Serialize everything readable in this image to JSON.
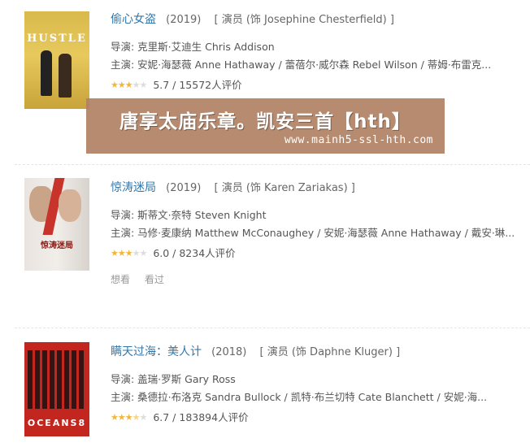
{
  "movies": [
    {
      "title": "偷心女盗",
      "year": "(2019)",
      "role": "[ 演员 (饰 Josephine Chesterfield) ]",
      "director": "导演: 克里斯·艾迪生 Chris Addison",
      "cast": "主演: 安妮·海瑟薇 Anne Hathaway / 蕾蓓尔·威尔森 Rebel Wilson / 蒂姆·布雷克...",
      "rating": "5.7 / 15572人评价",
      "stars": 3,
      "poster_text": "HUSTLE"
    },
    {
      "title": "惊涛迷局",
      "year": "(2019)",
      "role": "[ 演员 (饰 Karen Zariakas) ]",
      "director": "导演: 斯蒂文·奈特 Steven Knight",
      "cast": "主演: 马修·麦康纳 Matthew McConaughey / 安妮·海瑟薇 Anne Hathaway / 戴安·琳...",
      "rating": "6.0 / 8234人评价",
      "stars": 3,
      "actions": [
        "想看",
        "看过"
      ],
      "poster_text": "惊涛迷局"
    },
    {
      "title": "瞒天过海：美人计",
      "year": "(2018)",
      "role": "[ 演员 (饰 Daphne Kluger) ]",
      "director": "导演: 盖瑞·罗斯 Gary Ross",
      "cast": "主演: 桑德拉·布洛克 Sandra Bullock / 凯特·布兰切特 Cate Blanchett / 安妮·海...",
      "rating": "6.7 / 183894人评价",
      "stars": 3.5,
      "poster_text": "OCEANS8"
    }
  ],
  "overlay": {
    "main": "唐享太庙乐章。凯安三首【hth】",
    "sub": "www.mainh5-ssl-hth.com"
  },
  "colors": {
    "title_link": "#3377aa",
    "star": "#f4b638",
    "overlay_bg": "#b08264"
  }
}
